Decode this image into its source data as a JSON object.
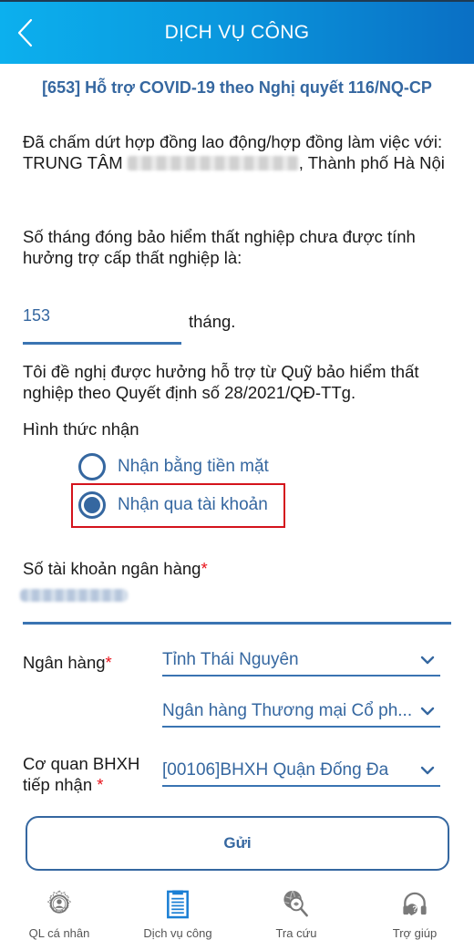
{
  "header": {
    "title": "DỊCH VỤ CÔNG",
    "back_icon": "chevron-left-icon"
  },
  "service_title": "[653] Hỗ trợ COVID-19 theo Nghị quyết 116/NQ-CP",
  "contract_text": {
    "prefix": "Đã chấm dứt hợp đồng  lao động/hợp đồng làm việc với: TRUNG TÂM ",
    "redacted": "[redacted]",
    "suffix": ", Thành phố Hà Nội"
  },
  "unemployment_months_text": "Số tháng đóng bảo hiểm thất nghiệp chưa được tính hưởng trợ cấp thất nghiệp là:",
  "months_field": {
    "value": "153",
    "unit": "tháng."
  },
  "request_text": "Tôi đề nghị được hưởng hỗ trợ từ Quỹ bảo hiểm thất nghiệp theo Quyết định số 28/2021/QĐ-TTg.",
  "receive_method": {
    "label": "Hình thức nhận",
    "options": [
      {
        "label": "Nhận bằng tiền mặt",
        "selected": false
      },
      {
        "label": "Nhận qua tài khoản",
        "selected": true
      }
    ]
  },
  "bank_account": {
    "label": "Số tài khoản ngân hàng",
    "required_mark": "*",
    "value": "[redacted]"
  },
  "bank": {
    "label": "Ngân hàng",
    "required_mark": "*",
    "province_value": "Tỉnh Thái Nguyên",
    "bank_value": "Ngân hàng Thương mại Cổ ph..."
  },
  "agency": {
    "label_line1": "Cơ quan BHXH",
    "label_line2": "tiếp nhận ",
    "required_mark": "*",
    "value": "[00106]BHXH Quận Đống Đa"
  },
  "submit_label": "Gửi",
  "bottom_nav": [
    {
      "label": "QL cá nhân",
      "icon": "gear-user-icon",
      "active": false
    },
    {
      "label": "Dịch vụ công",
      "icon": "clipboard-icon",
      "active": true
    },
    {
      "label": "Tra cứu",
      "icon": "globe-search-icon",
      "active": false
    },
    {
      "label": "Trợ giúp",
      "icon": "headset-help-icon",
      "active": false
    }
  ],
  "colors": {
    "header_start": "#0cb0ee",
    "header_end": "#0a6fc4",
    "accent": "#3567a0",
    "required": "#e8141c",
    "highlight": "#d4131c"
  }
}
